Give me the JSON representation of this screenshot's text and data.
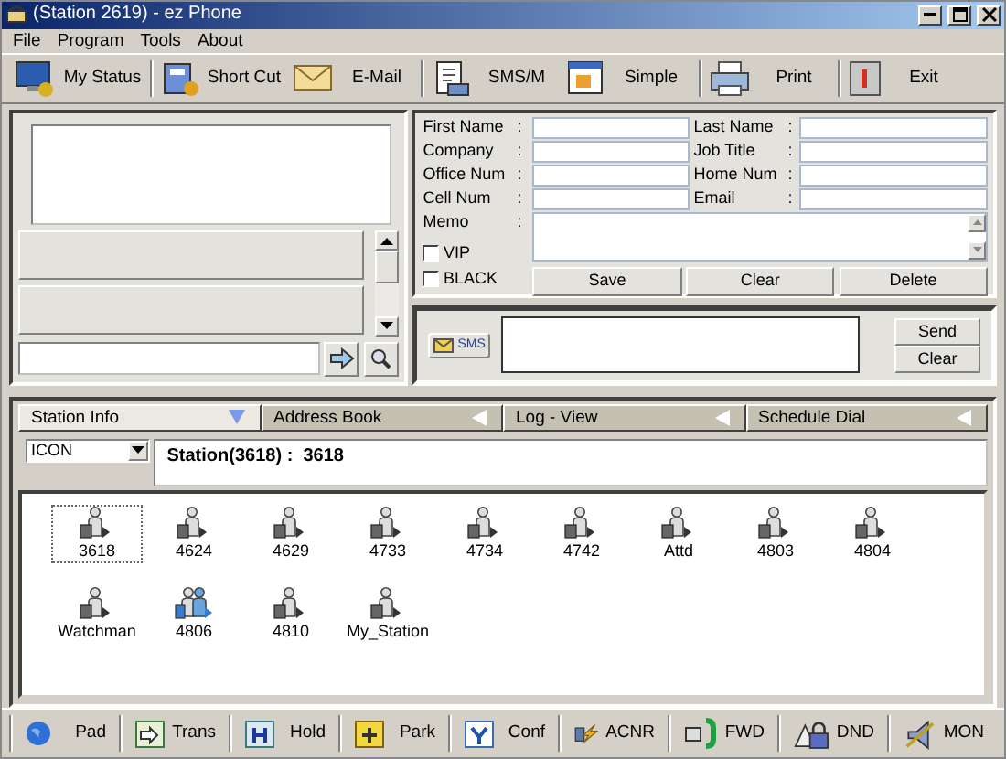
{
  "window": {
    "title": "(Station 2619) - ez Phone"
  },
  "menu": [
    "File",
    "Program",
    "Tools",
    "About"
  ],
  "toolbar": [
    {
      "label": "My Status"
    },
    {
      "label": "Short Cut"
    },
    {
      "label": "E-Mail"
    },
    {
      "label": "SMS/M"
    },
    {
      "label": "Simple"
    },
    {
      "label": "Print"
    },
    {
      "label": "Exit"
    }
  ],
  "contact_form": {
    "fields": [
      {
        "label": "First Name",
        "separator": ":"
      },
      {
        "label": "Last Name",
        "separator": ":"
      },
      {
        "label": "Company",
        "separator": ":"
      },
      {
        "label": "Job Title",
        "separator": ":"
      },
      {
        "label": "Office Num",
        "separator": ":"
      },
      {
        "label": "Home Num",
        "separator": ":"
      },
      {
        "label": "Cell Num",
        "separator": ":"
      },
      {
        "label": "Email",
        "separator": ":"
      }
    ],
    "memo": {
      "label": "Memo",
      "separator": ":"
    },
    "checkboxes": [
      {
        "label": "VIP",
        "checked": false
      },
      {
        "label": "BLACK",
        "checked": false
      }
    ],
    "buttons": [
      "Save",
      "Clear",
      "Delete"
    ]
  },
  "sms": {
    "badge": "SMS",
    "buttons": [
      "Send",
      "Clear"
    ]
  },
  "tabs": [
    {
      "label": "Station Info",
      "selected": true
    },
    {
      "label": "Address Book",
      "selected": false
    },
    {
      "label": "Log - View",
      "selected": false
    },
    {
      "label": "Schedule Dial",
      "selected": false
    }
  ],
  "view_select": {
    "value": "ICON"
  },
  "station_header": "Station(3618) :  3618",
  "stations": [
    {
      "label": "3618",
      "kind": "single",
      "selected": true
    },
    {
      "label": "4624",
      "kind": "single",
      "selected": false
    },
    {
      "label": "4629",
      "kind": "single",
      "selected": false
    },
    {
      "label": "4733",
      "kind": "single",
      "selected": false
    },
    {
      "label": "4734",
      "kind": "single",
      "selected": false
    },
    {
      "label": "4742",
      "kind": "single",
      "selected": false
    },
    {
      "label": "Attd",
      "kind": "single",
      "selected": false
    },
    {
      "label": "4803",
      "kind": "single",
      "selected": false
    },
    {
      "label": "4804",
      "kind": "single",
      "selected": false
    },
    {
      "label": "Watchman",
      "kind": "single",
      "selected": false
    },
    {
      "label": "4806",
      "kind": "group",
      "selected": false
    },
    {
      "label": "4810",
      "kind": "single",
      "selected": false
    },
    {
      "label": "My_Station",
      "kind": "single",
      "selected": false
    }
  ],
  "bottom_toolbar": [
    {
      "label": "Pad"
    },
    {
      "label": "Trans"
    },
    {
      "label": "Hold"
    },
    {
      "label": "Park"
    },
    {
      "label": "Conf"
    },
    {
      "label": "ACNR"
    },
    {
      "label": "FWD"
    },
    {
      "label": "DND"
    },
    {
      "label": "MON"
    }
  ]
}
